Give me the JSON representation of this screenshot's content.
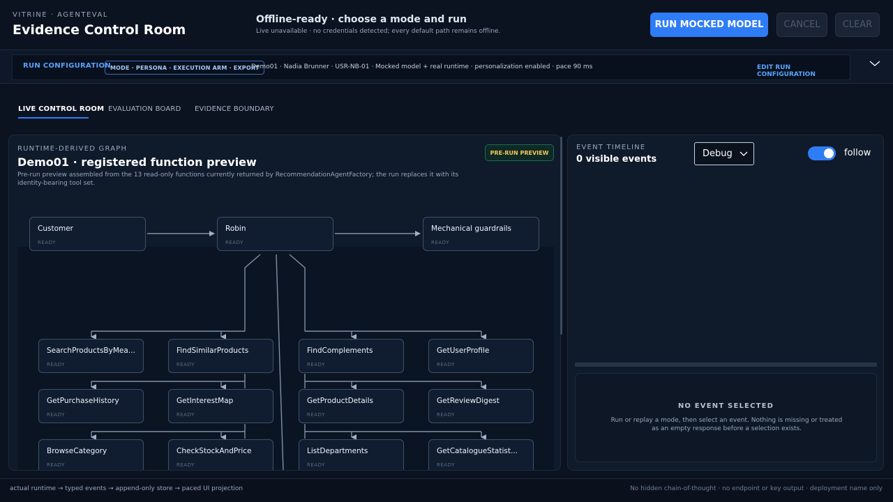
{
  "header": {
    "kicker": "VITRINE · AGENTEVAL",
    "title": "Evidence Control Room",
    "status_title": "Offline-ready · choose a mode and run",
    "status_sub": "Live unavailable · no credentials detected; every default path remains offline.",
    "run_label": "RUN MOCKED MODEL",
    "cancel_label": "CANCEL",
    "clear_label": "CLEAR"
  },
  "config": {
    "label": "RUN CONFIGURATION",
    "chip": "MODE · PERSONA · EXECUTION ARM · EXPORT",
    "summary": "Demo01 · Nadia Brunner · USR-NB-01 · Mocked model + real runtime · personalization enabled · pace 90 ms",
    "edit_label": "EDIT RUN CONFIGURATION"
  },
  "tabs": {
    "live": "LIVE CONTROL ROOM",
    "eval": "EVALUATION BOARD",
    "evidence": "EVIDENCE BOUNDARY"
  },
  "graph": {
    "kicker": "RUNTIME-DERIVED GRAPH",
    "title": "Demo01 · registered function preview",
    "description": "Pre-run preview assembled from the 13 read-only functions currently returned by RecommendationAgentFactory; the run replaces it with its identity-bearing tool set.",
    "badge": "PRE-RUN PREVIEW",
    "nodes": {
      "customer": {
        "name": "Customer",
        "state": "READY"
      },
      "robin": {
        "name": "Robin",
        "state": "READY"
      },
      "guardrails": {
        "name": "Mechanical guardrails",
        "state": "READY"
      },
      "search": {
        "name": "SearchProductsByMea...",
        "state": "READY"
      },
      "similar": {
        "name": "FindSimilarProducts",
        "state": "READY"
      },
      "complements": {
        "name": "FindComplements",
        "state": "READY"
      },
      "profile": {
        "name": "GetUserProfile",
        "state": "READY"
      },
      "purchase": {
        "name": "GetPurchaseHistory",
        "state": "READY"
      },
      "interest": {
        "name": "GetInterestMap",
        "state": "READY"
      },
      "details": {
        "name": "GetProductDetails",
        "state": "READY"
      },
      "review": {
        "name": "GetReviewDigest",
        "state": "READY"
      },
      "browse": {
        "name": "BrowseCategory",
        "state": "READY"
      },
      "stock": {
        "name": "CheckStockAndPrice",
        "state": "READY"
      },
      "departments": {
        "name": "ListDepartments",
        "state": "READY"
      },
      "statistics": {
        "name": "GetCatalogueStatist...",
        "state": "READY"
      }
    }
  },
  "timeline": {
    "kicker": "EVENT TIMELINE",
    "count": "0 visible events",
    "level": "Debug",
    "follow_label": "follow",
    "follow_on": true,
    "empty_title": "NO EVENT SELECTED",
    "empty_text": "Run or replay a mode, then select an event. Nothing is missing or treated as an empty response before a selection exists."
  },
  "footer": {
    "left": "actual runtime → typed events → append-only store → paced UI projection",
    "right": "No hidden chain-of-thought · no endpoint or key output · deployment name only"
  },
  "colors": {
    "accent": "#2f7df6",
    "badge_text": "#f2c85b",
    "badge_border": "#1e6a52"
  }
}
